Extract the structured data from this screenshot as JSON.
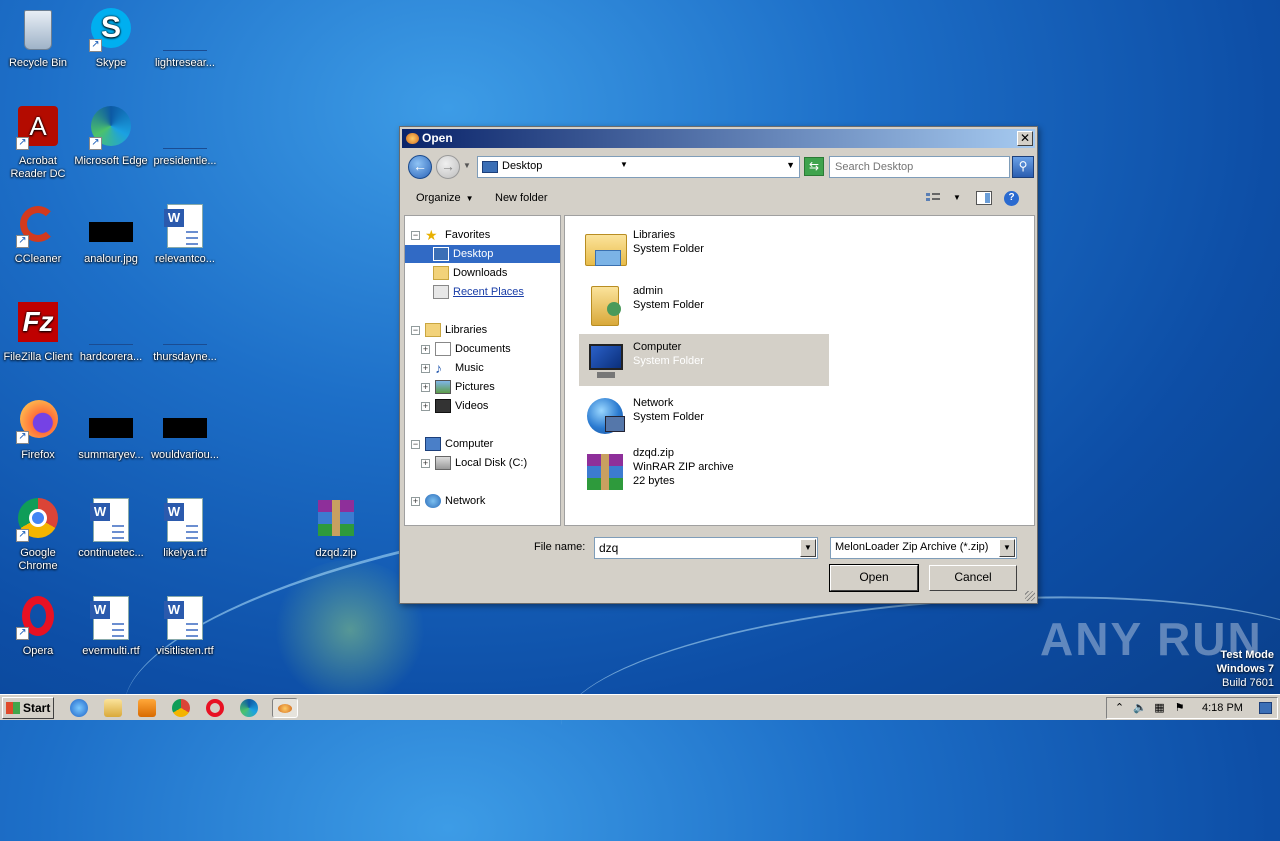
{
  "desktop": {
    "icons": [
      {
        "label": "Recycle Bin"
      },
      {
        "label": "Skype"
      },
      {
        "label": "lightresear..."
      },
      {
        "label": "Acrobat Reader DC"
      },
      {
        "label": "Microsoft Edge"
      },
      {
        "label": "presidentle..."
      },
      {
        "label": "CCleaner"
      },
      {
        "label": "analour.jpg"
      },
      {
        "label": "relevantco..."
      },
      {
        "label": "FileZilla Client"
      },
      {
        "label": "hardcorera..."
      },
      {
        "label": "thursdayne..."
      },
      {
        "label": "Firefox"
      },
      {
        "label": "summaryev..."
      },
      {
        "label": "wouldvariou..."
      },
      {
        "label": "Google Chrome"
      },
      {
        "label": "continuetec..."
      },
      {
        "label": "likelya.rtf"
      },
      {
        "label": "dzqd.zip"
      },
      {
        "label": "Opera"
      },
      {
        "label": "evermulti.rtf"
      },
      {
        "label": "visitlisten.rtf"
      }
    ]
  },
  "dialog": {
    "title": "Open",
    "close_label": "✕",
    "address": "Desktop",
    "search_placeholder": "Search Desktop",
    "organize_label": "Organize",
    "new_folder_label": "New folder",
    "nav": {
      "favorites": "Favorites",
      "desktop": "Desktop",
      "downloads": "Downloads",
      "recent_places": "Recent Places",
      "libraries": "Libraries",
      "documents": "Documents",
      "music": "Music",
      "pictures": "Pictures",
      "videos": "Videos",
      "computer": "Computer",
      "local_disk": "Local Disk (C:)",
      "network": "Network"
    },
    "files": [
      {
        "name": "Libraries",
        "type": "System Folder",
        "icon": "libraries-icon"
      },
      {
        "name": "admin",
        "type": "System Folder",
        "icon": "user-folder-icon"
      },
      {
        "name": "Computer",
        "type": "System Folder",
        "icon": "computer-icon"
      },
      {
        "name": "Network",
        "type": "System Folder",
        "icon": "network-icon"
      },
      {
        "name": "dzqd.zip",
        "type": "WinRAR ZIP archive",
        "size": "22 bytes",
        "icon": "winrar-icon"
      }
    ],
    "file_name_label": "File name:",
    "file_name_value": "dzq",
    "file_type_value": "MelonLoader Zip Archive (*.zip)",
    "open_label": "Open",
    "cancel_label": "Cancel"
  },
  "taskbar": {
    "start_label": "Start",
    "clock": "4:18 PM"
  },
  "watermark": "ANY RUN",
  "test_mode": {
    "line1": "Test Mode",
    "line2": "Windows 7",
    "line3": "Build 7601"
  },
  "colors": {
    "selection": "#316ac5",
    "titlebar_start": "#0a246a",
    "titlebar_end": "#a6caf0",
    "face": "#d4d0c8"
  }
}
